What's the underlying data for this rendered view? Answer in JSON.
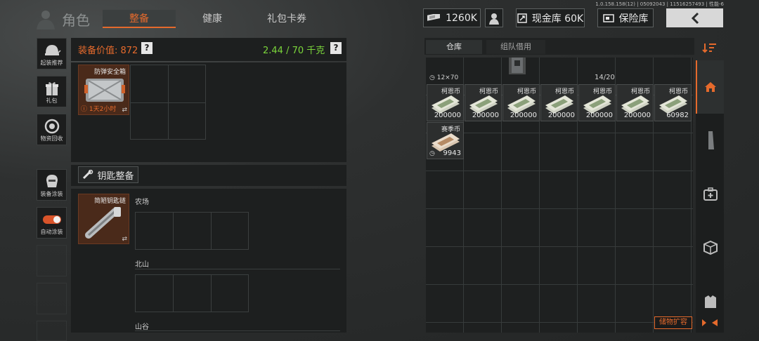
{
  "version": "1.0.158.158(12) | 05092043 | 11516257493 | 性能-6",
  "header": {
    "title": "角色",
    "tabs": [
      {
        "label": "整备",
        "active": true
      },
      {
        "label": "健康",
        "active": false
      },
      {
        "label": "礼包卡券",
        "active": false
      }
    ],
    "currency": "1260K",
    "cash_vault": "现金库 60K",
    "safe_vault": "保险库"
  },
  "left_sidebar": {
    "items": [
      {
        "label": "起装推荐",
        "icon": "helmet-icon"
      },
      {
        "label": "礼包",
        "icon": "gift-icon"
      },
      {
        "label": "物资回收",
        "icon": "recycle-icon"
      },
      {
        "label": "装备涂装",
        "icon": "mask-icon"
      },
      {
        "label": "自动涂装",
        "icon": "toggle-icon"
      }
    ]
  },
  "loadout": {
    "value_label": "装备价值: 872",
    "weight": "2.44 / 70 千克",
    "help": "?",
    "secure_case": {
      "name": "防弹安全箱",
      "timer": "1天2小时"
    },
    "key_section": {
      "title": "钥匙整备",
      "keychain_name": "简陋钥匙链"
    },
    "key_groups": [
      "农场",
      "北山",
      "山谷"
    ]
  },
  "inventory": {
    "tabs": [
      {
        "label": "仓库",
        "active": true
      },
      {
        "label": "组队借用",
        "active": false
      }
    ],
    "top_row": {
      "capacity": "12×70",
      "count": "14/20"
    },
    "items": [
      {
        "name": "柯恩币",
        "count": "200000"
      },
      {
        "name": "柯恩币",
        "count": "200000"
      },
      {
        "name": "柯恩币",
        "count": "200000"
      },
      {
        "name": "柯恩币",
        "count": "200000"
      },
      {
        "name": "柯恩币",
        "count": "200000"
      },
      {
        "name": "柯恩币",
        "count": "200000"
      },
      {
        "name": "柯恩币",
        "count": "60982"
      },
      {
        "name": "赛季币",
        "count": "9943"
      }
    ],
    "expand_label": "储物扩容"
  },
  "colors": {
    "accent": "#e56a2c",
    "green": "#7bd63b",
    "panel": "#1d1f1f"
  }
}
